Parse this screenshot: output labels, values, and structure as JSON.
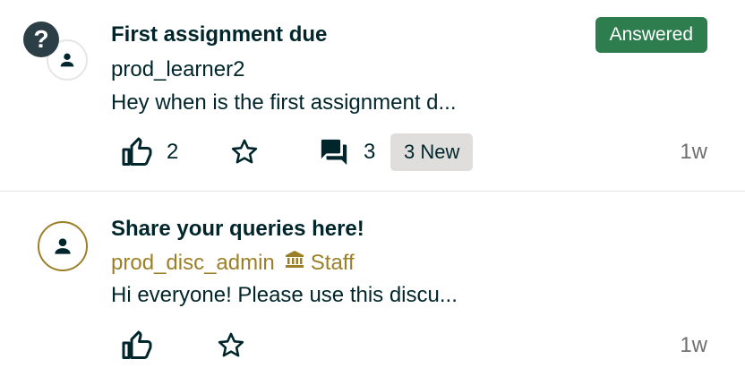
{
  "colors": {
    "primary_text": "#00262b",
    "staff_gold": "#9c8028",
    "answered_green": "#2e7d4f",
    "muted_time": "#707070",
    "new_badge_bg": "#e0dedc"
  },
  "posts": [
    {
      "title": "First assignment due",
      "author": "prod_learner2",
      "preview": "Hey when is the first assignment d...",
      "status_badge": "Answered",
      "type_icon": "question-icon",
      "likes": "2",
      "comments": "3",
      "new_badge": "3 New",
      "time": "1w"
    },
    {
      "title": "Share your queries here!",
      "author": "prod_disc_admin",
      "role_label": "Staff",
      "role_icon": "institution-icon",
      "preview": "Hi everyone! Please use this discu...",
      "time": "1w"
    }
  ]
}
